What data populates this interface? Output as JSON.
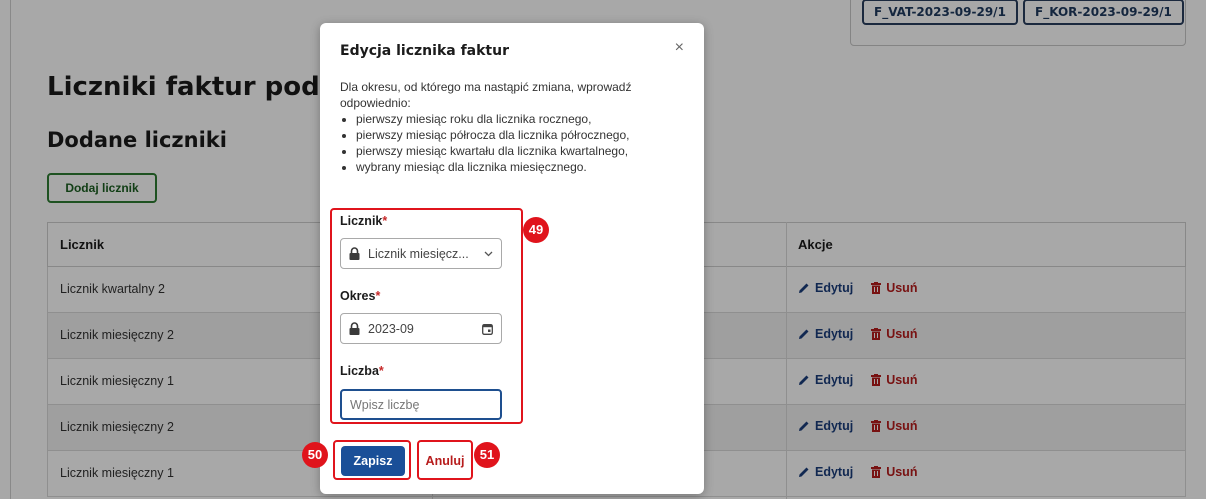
{
  "background": {
    "tags": [
      "F_VAT-2023-09-29/1",
      "F_KOR-2023-09-29/1"
    ],
    "title": "Liczniki faktur podsta",
    "subtitle": "Dodane liczniki",
    "add_button": "Dodaj licznik",
    "table": {
      "columns": [
        "Licznik",
        "Akcje"
      ],
      "rows": [
        {
          "name": "Licznik kwartalny 2"
        },
        {
          "name": "Licznik miesięczny 2"
        },
        {
          "name": "Licznik miesięczny 1"
        },
        {
          "name": "Licznik miesięczny 2"
        },
        {
          "name": "Licznik miesięczny 1"
        }
      ],
      "edit_label": "Edytuj",
      "delete_label": "Usuń"
    }
  },
  "modal": {
    "title": "Edycja licznika faktur",
    "close_glyph": "×",
    "intro": "Dla okresu, od którego ma nastąpić zmiana, wprowadź odpowiednio:",
    "bullets": [
      "pierwszy miesiąc roku dla licznika rocznego,",
      "pierwszy miesiąc półrocza dla licznika półrocznego,",
      "pierwszy miesiąc kwartału dla licznika kwartalnego,",
      "wybrany miesiąc dla licznika miesięcznego."
    ],
    "fields": {
      "counter_label": "Licznik",
      "counter_value": "Licznik miesięcz...",
      "period_label": "Okres",
      "period_value": "2023-09",
      "number_label": "Liczba",
      "number_placeholder": "Wpisz liczbę"
    },
    "required_mark": "*",
    "save_label": "Zapisz",
    "cancel_label": "Anuluj"
  },
  "annotations": [
    "49",
    "50",
    "51"
  ],
  "icons": {
    "lock": "lock-icon",
    "chevron": "chevron-down-icon",
    "calendar": "calendar-icon",
    "pencil": "pencil-icon",
    "trash": "trash-icon"
  },
  "colors": {
    "primary": "#1a4f98",
    "danger": "#b71c1c",
    "annotation": "#e0141c",
    "add_button": "#2e7d32"
  }
}
